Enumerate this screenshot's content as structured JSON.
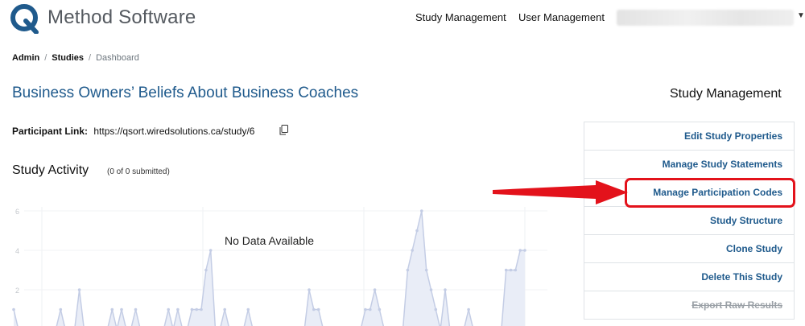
{
  "header": {
    "brand": "Method Software",
    "nav": [
      "Study Management",
      "User Management"
    ]
  },
  "breadcrumb": {
    "items": [
      "Admin",
      "Studies"
    ],
    "current": "Dashboard"
  },
  "study": {
    "title": "Business Owners’ Beliefs About Business Coaches",
    "participant_label": "Participant Link:",
    "participant_url": "https://qsort.wiredsolutions.ca/study/6"
  },
  "activity": {
    "title": "Study Activity",
    "subtitle": "(0 of 0 submitted)",
    "no_data": "No Data Available"
  },
  "chart_data": {
    "type": "area",
    "ylim": [
      0,
      6
    ],
    "y_ticks": [
      "6",
      "4",
      "2"
    ],
    "values": [
      1,
      0,
      0,
      0,
      0,
      0,
      0,
      0,
      0,
      0,
      1,
      0,
      0,
      0,
      2,
      0,
      0,
      0,
      0,
      0,
      0,
      1,
      0,
      1,
      0,
      0,
      1,
      0,
      0,
      0,
      0,
      0,
      0,
      1,
      0,
      1,
      0,
      0,
      1,
      1,
      1,
      3,
      4,
      0,
      0,
      1,
      0,
      0,
      0,
      0,
      1,
      0,
      0,
      0,
      0,
      0,
      0,
      0,
      0,
      0,
      0,
      0,
      0,
      2,
      1,
      1,
      0,
      0,
      0,
      0,
      0,
      0,
      0,
      0,
      0,
      1,
      1,
      2,
      1,
      0,
      0,
      0,
      0,
      0,
      3,
      4,
      5,
      6,
      3,
      2,
      1,
      0,
      2,
      0,
      0,
      0,
      0,
      1,
      0,
      0,
      0,
      0,
      0,
      0,
      0,
      3,
      3,
      3,
      4,
      4
    ]
  },
  "panel": {
    "title": "Study Management",
    "items": [
      "Edit Study Properties",
      "Manage Study Statements",
      "Manage Participation Codes",
      "Study Structure",
      "Clone Study",
      "Delete This Study",
      "Export Raw Results"
    ]
  },
  "colors": {
    "accent": "#1f5a8c",
    "highlight": "#e3121b",
    "chart_fill": "#e9edf7",
    "chart_line": "#c4cde5"
  }
}
